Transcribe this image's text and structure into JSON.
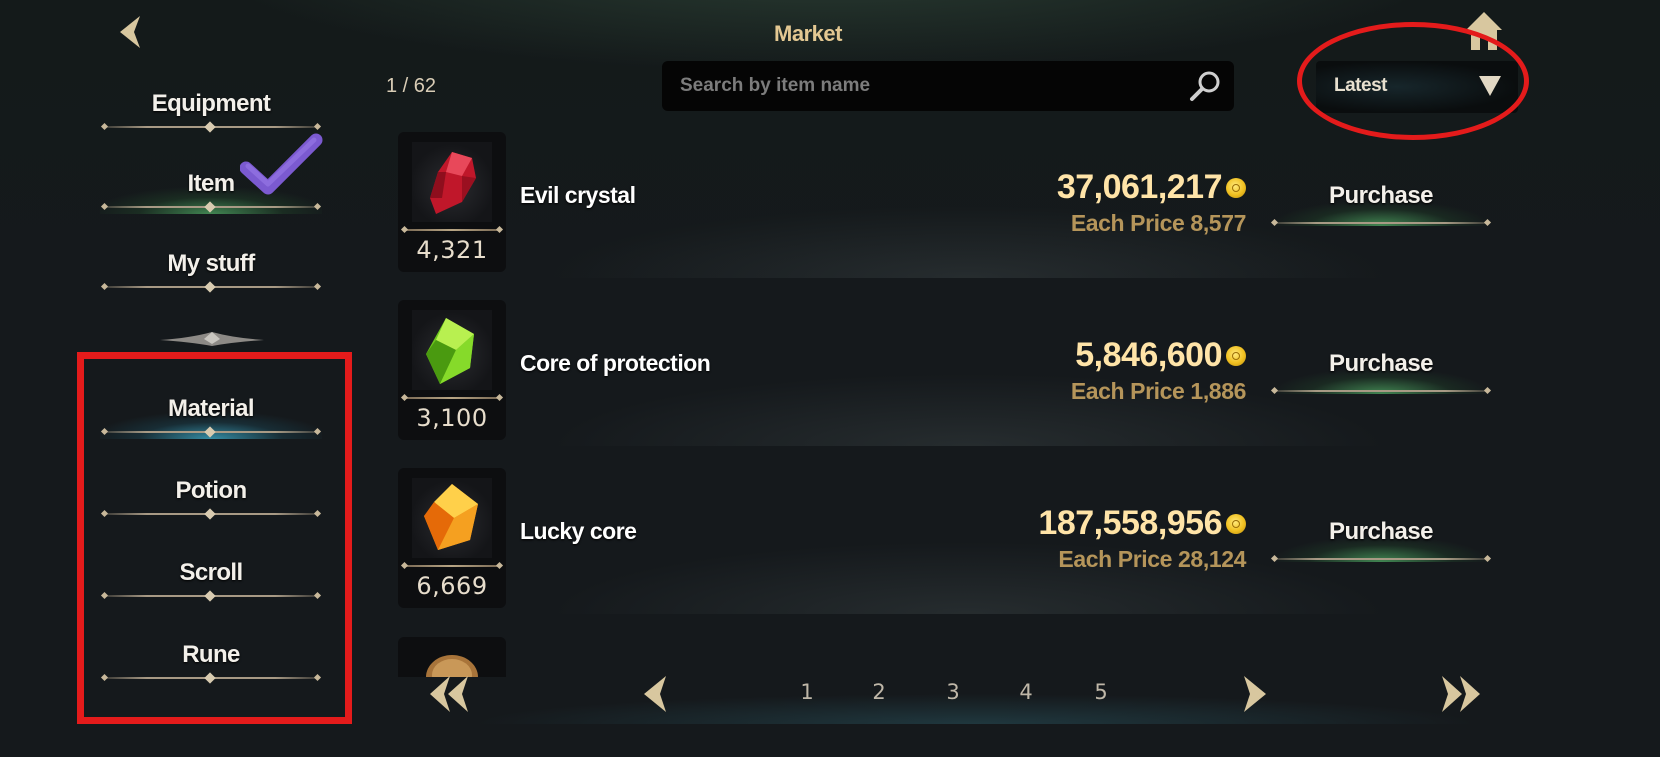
{
  "header": {
    "title": "Market",
    "page_count": "1 / 62"
  },
  "search": {
    "placeholder": "Search by item name"
  },
  "sort": {
    "selected": "Latest"
  },
  "sidebar": {
    "items": [
      {
        "label": "Equipment"
      },
      {
        "label": "Item"
      },
      {
        "label": "My stuff"
      }
    ],
    "subitems": [
      {
        "label": "Material"
      },
      {
        "label": "Potion"
      },
      {
        "label": "Scroll"
      },
      {
        "label": "Rune"
      }
    ]
  },
  "listings": [
    {
      "name": "Evil crystal",
      "quantity": "4,321",
      "price": "37,061,217",
      "each_price": "Each Price 8,577",
      "button": "Purchase",
      "icon": "red-crystal-icon"
    },
    {
      "name": "Core of protection",
      "quantity": "3,100",
      "price": "5,846,600",
      "each_price": "Each Price 1,886",
      "button": "Purchase",
      "icon": "green-gem-icon"
    },
    {
      "name": "Lucky core",
      "quantity": "6,669",
      "price": "187,558,956",
      "each_price": "Each Price 28,124",
      "button": "Purchase",
      "icon": "orange-gem-icon"
    }
  ],
  "pagination": {
    "pages": [
      "1",
      "2",
      "3",
      "4",
      "5"
    ]
  },
  "colors": {
    "gold": "#ffe4a8",
    "each_price": "#b5955a",
    "annotation_red": "#e41b1b",
    "title": "#e3c892"
  }
}
